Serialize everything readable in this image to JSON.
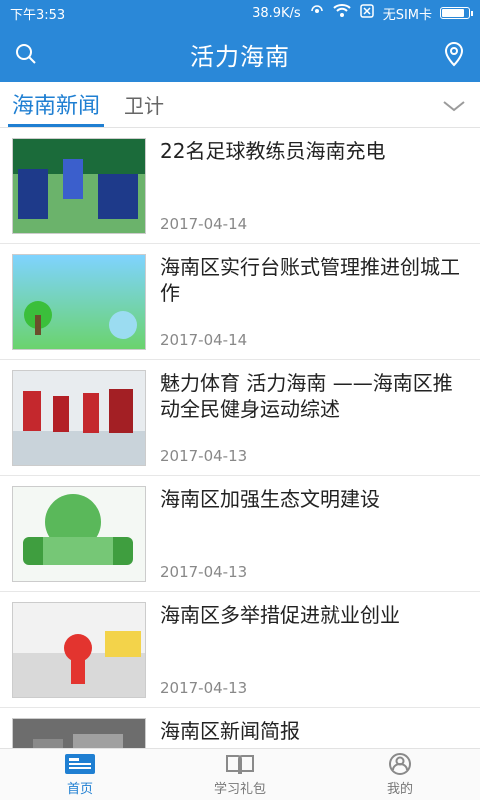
{
  "status": {
    "time": "下午3:53",
    "speed": "38.9K/s",
    "sim": "无SIM卡"
  },
  "appbar": {
    "title": "活力海南",
    "left_icon": "search-icon",
    "right_icon": "location-pin-icon"
  },
  "tabs": [
    {
      "label": "海南新闻"
    },
    {
      "label": "卫计"
    }
  ],
  "news": [
    {
      "title": "22名足球教练员海南充电",
      "date": "2017-04-14",
      "thumb": "soccer-training"
    },
    {
      "title": "海南区实行台账式管理推进创城工作",
      "date": "2017-04-14",
      "thumb": "harmony-poster"
    },
    {
      "title": "魅力体育 活力海南 ——海南区推动全民健身运动综述",
      "date": "2017-04-13",
      "thumb": "fitness-exercise"
    },
    {
      "title": "海南区加强生态文明建设",
      "date": "2017-04-13",
      "thumb": "ecology-logo"
    },
    {
      "title": "海南区多举措促进就业创业",
      "date": "2017-04-13",
      "thumb": "jobs-startups"
    },
    {
      "title": "海南区新闻简报",
      "date": "",
      "thumb": "news-brief"
    }
  ],
  "bottom_nav": [
    {
      "label": "首页",
      "icon": "home-news-icon"
    },
    {
      "label": "学习礼包",
      "icon": "book-icon"
    },
    {
      "label": "我的",
      "icon": "profile-icon"
    }
  ],
  "colors": {
    "primary": "#2a88d8",
    "accent": "#1f7fd2",
    "text": "#222222",
    "muted": "#888888"
  }
}
